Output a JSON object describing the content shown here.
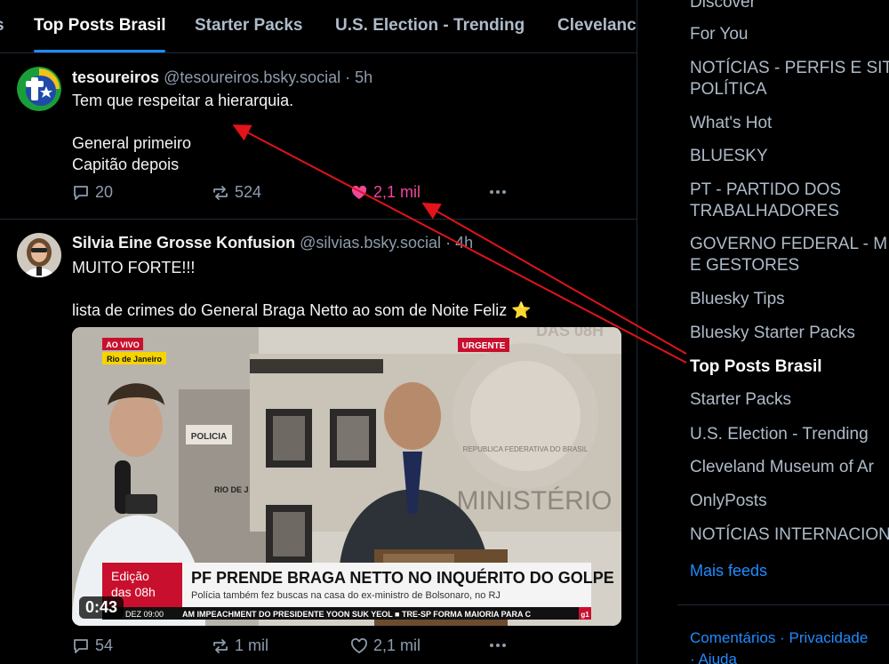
{
  "tabs": [
    "s",
    "Top Posts Brasil",
    "Starter Packs",
    "U.S. Election - Trending",
    "Clevelanc"
  ],
  "posts": [
    {
      "author": "tesoureiros",
      "handle": "@tesoureiros.bsky.social",
      "dot": "·",
      "time": "5h",
      "lines": [
        "Tem que respeitar a hierarquia.",
        "",
        "General primeiro",
        "Capitão depois"
      ],
      "replies": "20",
      "reposts": "524",
      "likes": "2,1 mil",
      "liked": true
    },
    {
      "author": "Silvia Eine Grosse Konfusion",
      "handle": "@silvias.bsky.social",
      "dot": "·",
      "time": "4h",
      "lines": [
        "MUITO FORTE!!!",
        "",
        "lista de crimes do General Braga Netto ao som de Noite Feliz ⭐"
      ],
      "video": {
        "duration": "0:43",
        "live_badge": "AO VIVO",
        "location": "Rio de Janeiro",
        "urgent_badge": "URGENTE",
        "edition": "Edição das 08h",
        "headline": "PF PRENDE BRAGA NETTO NO INQUÉRITO DO GOLPE",
        "subheadline": "Polícia também fez buscas na casa do ex-ministro de Bolsonaro, no RJ",
        "ticker": "AM IMPEACHMENT DO PRESIDENTE YOON SUK YEOL  ■  TRE-SP FORMA MAIORIA PARA C",
        "ticker_date": "DEZ  09:00",
        "wall_sign": "POLICIA",
        "wall_text": "RIO DE J",
        "ministry_text": "MINISTÉRIO",
        "seal_text": "REPUBLICA FEDERATIVA DO BRASIL",
        "top_right_text": "DAS 08H",
        "channel": "g1"
      },
      "replies": "54",
      "reposts": "1 mil",
      "likes": "2,1 mil",
      "liked": false
    }
  ],
  "sidebar": {
    "items": [
      "Discover",
      "For You",
      "NOTÍCIAS - PERFIS E SIT",
      "POLÍTICA",
      "What's Hot",
      "BLUESKY",
      "PT - PARTIDO DOS",
      "TRABALHADORES",
      "GOVERNO FEDERAL - M",
      "E GESTORES",
      "Bluesky Tips",
      "Bluesky Starter Packs",
      "Top Posts Brasil",
      "Starter Packs",
      "U.S. Election - Trending",
      "Cleveland Museum of Ar",
      "OnlyPosts",
      "NOTÍCIAS INTERNACION"
    ],
    "more_feeds": "Mais feeds",
    "footer": [
      "Comentários",
      "·",
      "Privacidade",
      "·",
      "Ajuda"
    ]
  },
  "colors": {
    "accent": "#208bfe",
    "like": "#ec4899",
    "arrow": "#e0141a",
    "muted": "#8d9cad"
  }
}
